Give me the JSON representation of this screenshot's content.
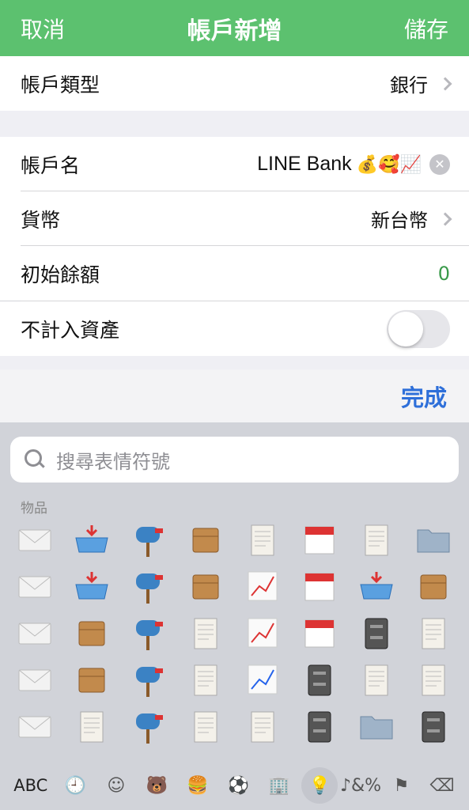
{
  "header": {
    "cancel": "取消",
    "title": "帳戶新增",
    "save": "儲存"
  },
  "colors": {
    "header": "#5cc16f",
    "accent": "#2e6fd9",
    "balance": "#3a9a4a"
  },
  "account_type": {
    "label": "帳戶類型",
    "value": "銀行"
  },
  "account_name": {
    "label": "帳戶名",
    "value": "LINE Bank",
    "emoji": [
      "💰",
      "🥰",
      "📈"
    ]
  },
  "currency": {
    "label": "貨幣",
    "value": "新台幣"
  },
  "initial_balance": {
    "label": "初始餘額",
    "value": "0"
  },
  "exclude_assets": {
    "label": "不計入資產",
    "on": false
  },
  "accessory": {
    "done": "完成"
  },
  "keyboard": {
    "search_placeholder": "搜尋表情符號",
    "category": "物品",
    "emojis": [
      "envelope",
      "inbox-tray",
      "mailbox-lowered",
      "postal-horn",
      "receipt",
      "spiral-calendar",
      "card-file-box",
      "folder",
      "envelope-arrow",
      "outbox-tray",
      "mailbox-raised",
      "scroll",
      "bar-chart",
      "calendar",
      "ballot-box",
      "card-index",
      "incoming-envelope",
      "package",
      "mailbox-open",
      "page-curl",
      "chart-increasing",
      "tear-off-calendar",
      "file-cabinet",
      "rolled-newspaper",
      "e-mail",
      "label-tag",
      "mailbox-closed",
      "page-facing-up",
      "chart-decreasing",
      "wastebasket",
      "clipboard",
      "newspaper",
      "love-letter",
      "placard",
      "postbox",
      "bookmark-tabs",
      "spiral-notepad",
      "printer",
      "folder-2",
      "notebook"
    ],
    "tabs": [
      {
        "label": "ABC",
        "icon": "abc-key",
        "selected": false
      },
      {
        "label": "🕘",
        "icon": "clock-icon",
        "selected": false
      },
      {
        "label": "☺",
        "icon": "smiley-icon",
        "selected": false
      },
      {
        "label": "🐻",
        "icon": "bear-icon",
        "selected": false
      },
      {
        "label": "🍔",
        "icon": "food-icon",
        "selected": false
      },
      {
        "label": "⚽",
        "icon": "ball-icon",
        "selected": false
      },
      {
        "label": "🏢",
        "icon": "building-icon",
        "selected": false
      },
      {
        "label": "💡",
        "icon": "lightbulb-icon",
        "selected": true
      },
      {
        "label": "♪&%",
        "icon": "symbols-icon",
        "selected": false
      },
      {
        "label": "⚑",
        "icon": "flag-icon",
        "selected": false
      },
      {
        "label": "⌫",
        "icon": "delete-icon",
        "selected": false
      }
    ]
  }
}
